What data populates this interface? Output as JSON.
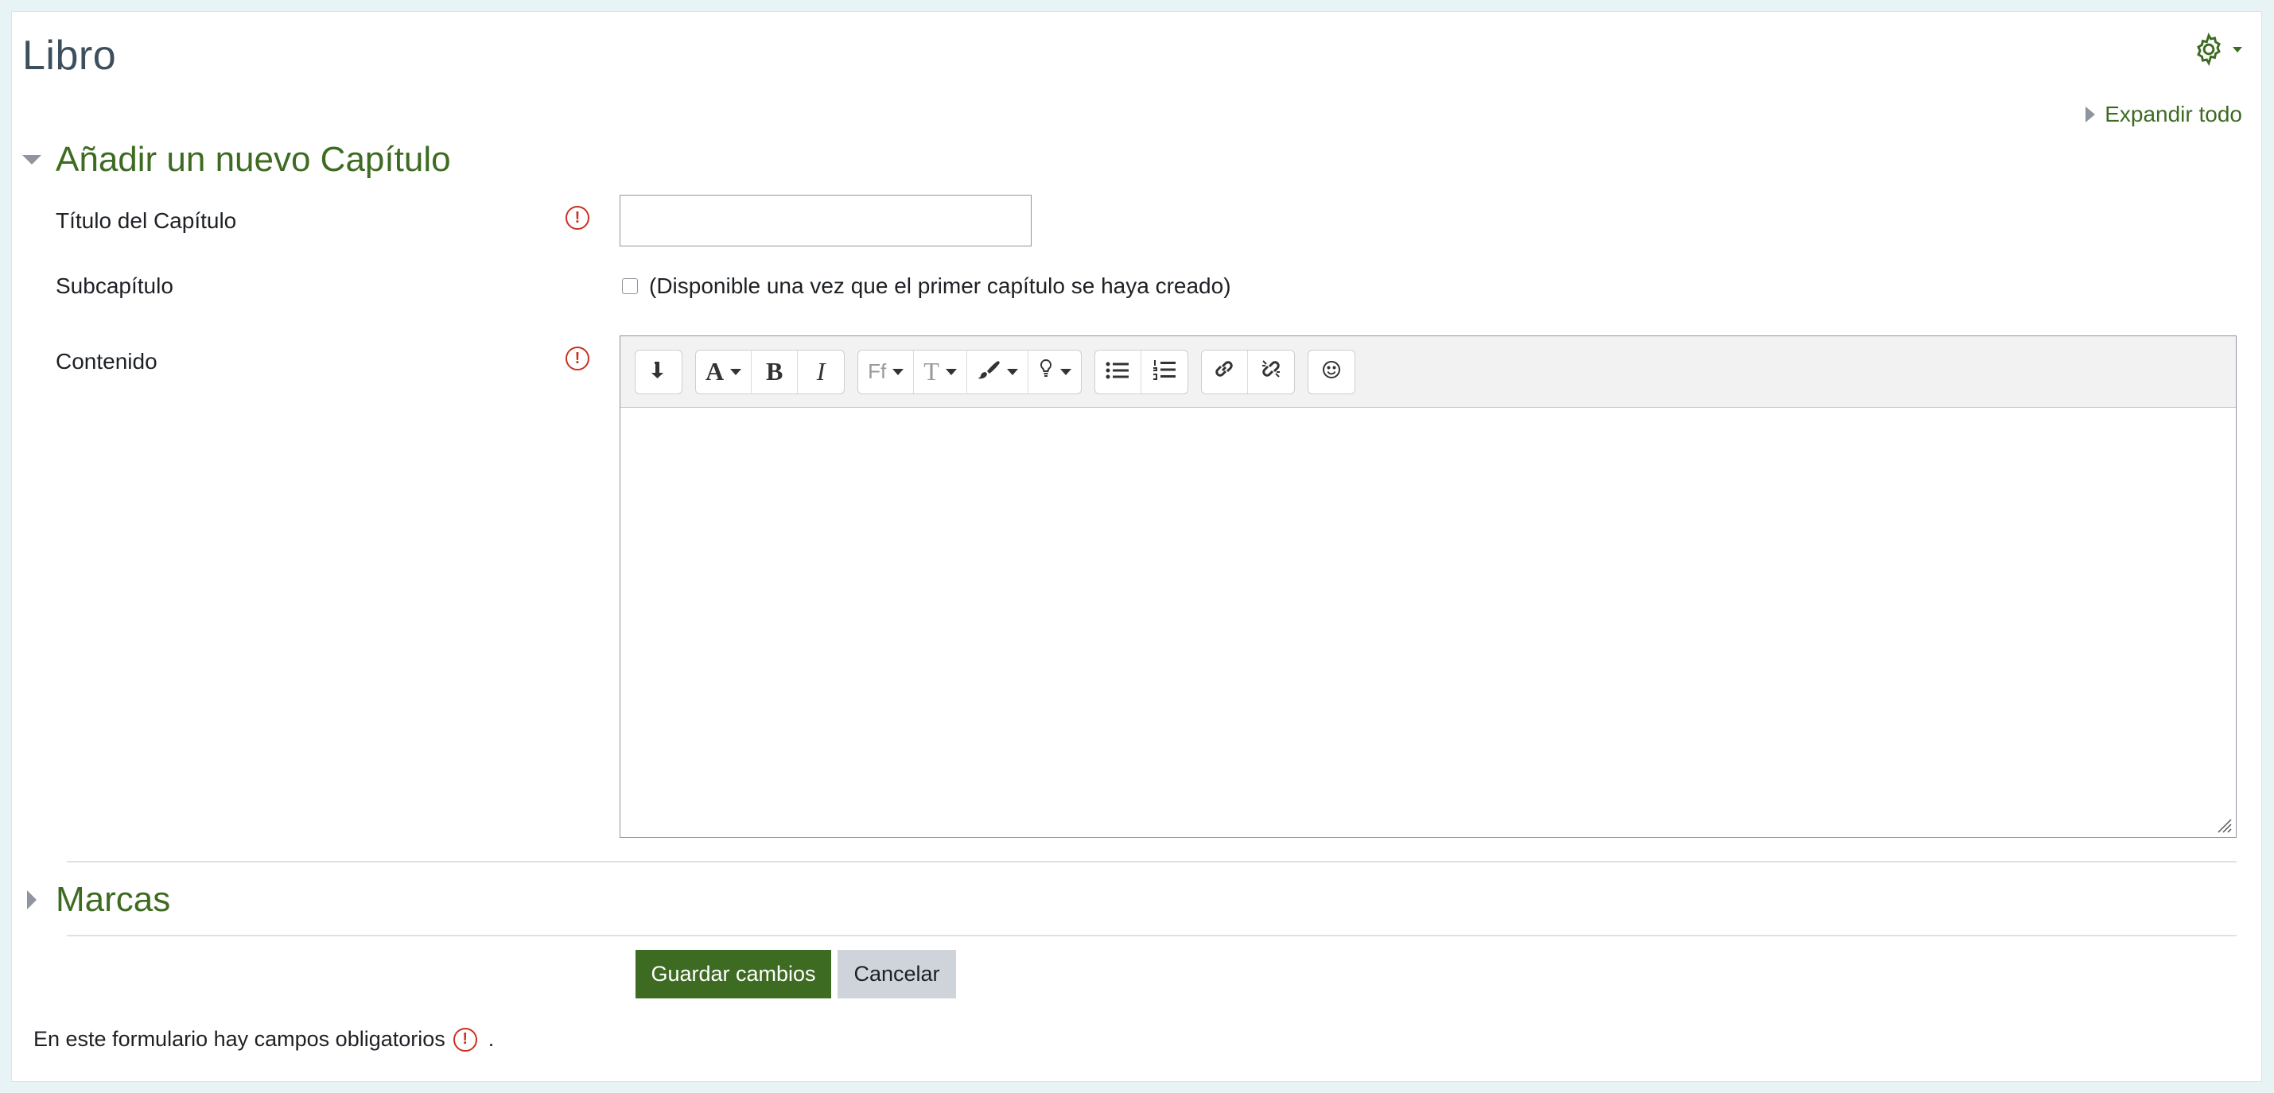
{
  "page": {
    "title": "Libro"
  },
  "header": {
    "settings_icon": "gear-icon",
    "expand_all_label": "Expandir todo"
  },
  "sections": {
    "new_chapter": {
      "title": "Añadir un nuevo Capítulo"
    },
    "tags": {
      "title": "Marcas"
    }
  },
  "form": {
    "title_label": "Título del Capítulo",
    "title_value": "",
    "subchapter_label": "Subcapítulo",
    "subchapter_checkbox_label": "(Disponible una vez que el primer capítulo se haya creado)",
    "content_label": "Contenido",
    "content_value": "",
    "required_icon_glyph": "!"
  },
  "editor": {
    "toolbar": {
      "font_color_glyph": "A",
      "bold_glyph": "B",
      "italic_glyph": "I",
      "font_family_glyph": "Ff",
      "font_size_glyph": "T"
    }
  },
  "actions": {
    "save_label": "Guardar cambios",
    "cancel_label": "Cancelar"
  },
  "footer": {
    "note": "En este formulario hay campos obligatorios",
    "note_suffix": "."
  },
  "colors": {
    "accent": "#3e6b22",
    "required": "#ca3120",
    "title": "#3d4f5c"
  }
}
